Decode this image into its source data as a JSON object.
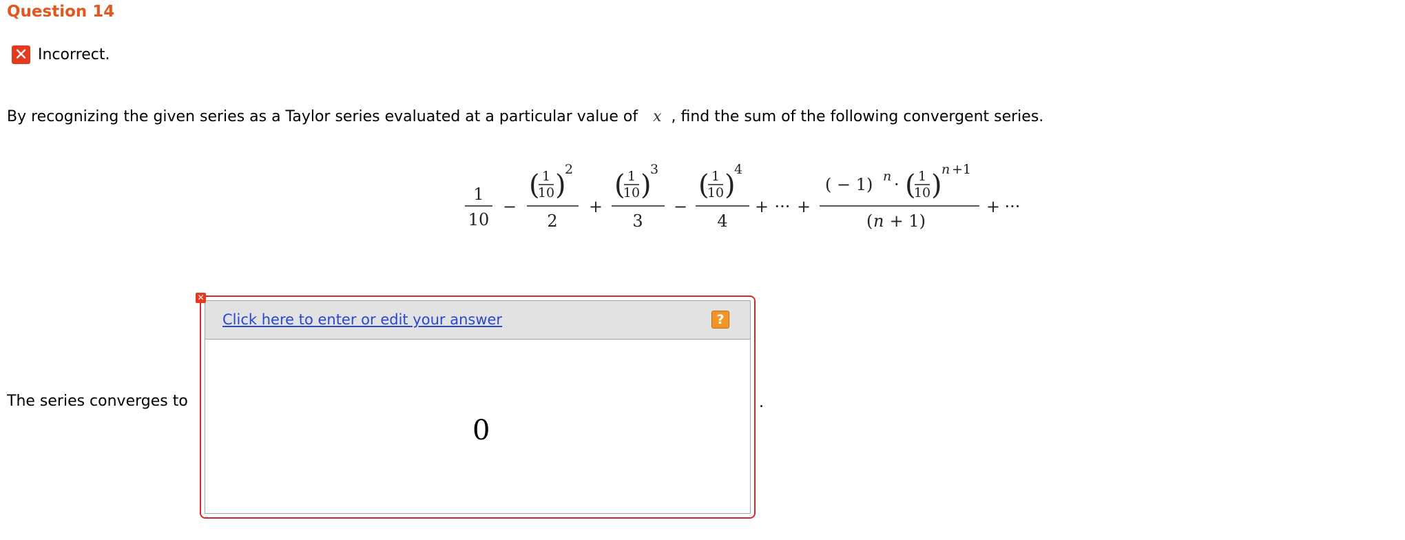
{
  "question": {
    "title": "Question 14"
  },
  "status": {
    "icon": "incorrect-x-icon",
    "symbol": "✕",
    "text": "Incorrect.",
    "color": "#e53a1f"
  },
  "prompt": {
    "before_var": "By recognizing the given series as a Taylor series evaluated at a particular value of",
    "variable": "x",
    "after_var": ", find the sum of the following convergent series."
  },
  "series": {
    "t1_num": "1",
    "t1_den": "10",
    "op1": "−",
    "inner_num": "1",
    "inner_den": "10",
    "exp2": "2",
    "den2": "2",
    "op2": "+",
    "exp3": "3",
    "den3": "3",
    "op3": "−",
    "exp4": "4",
    "den4": "4",
    "plus_a": "+",
    "dots_a": "···",
    "plus_b": "+",
    "gen_sign": "( − 1)",
    "gen_n": "n",
    "gen_dot": "·",
    "gen_exp_n": "n",
    "gen_exp_rest": "+1",
    "gen_den_open": "(",
    "gen_den_n": "n",
    "gen_den_rest": " + 1)",
    "plus_c": "+",
    "dots_c": "···"
  },
  "answer": {
    "lead": "The series converges to",
    "edit_link": "Click here to enter or edit your answer",
    "help_label": "?",
    "value": "0",
    "close_symbol": "✕",
    "trailing": "."
  },
  "colors": {
    "accent": "#e2571e",
    "error": "#e0242b",
    "link": "#2a46d4",
    "help": "#f39524"
  }
}
